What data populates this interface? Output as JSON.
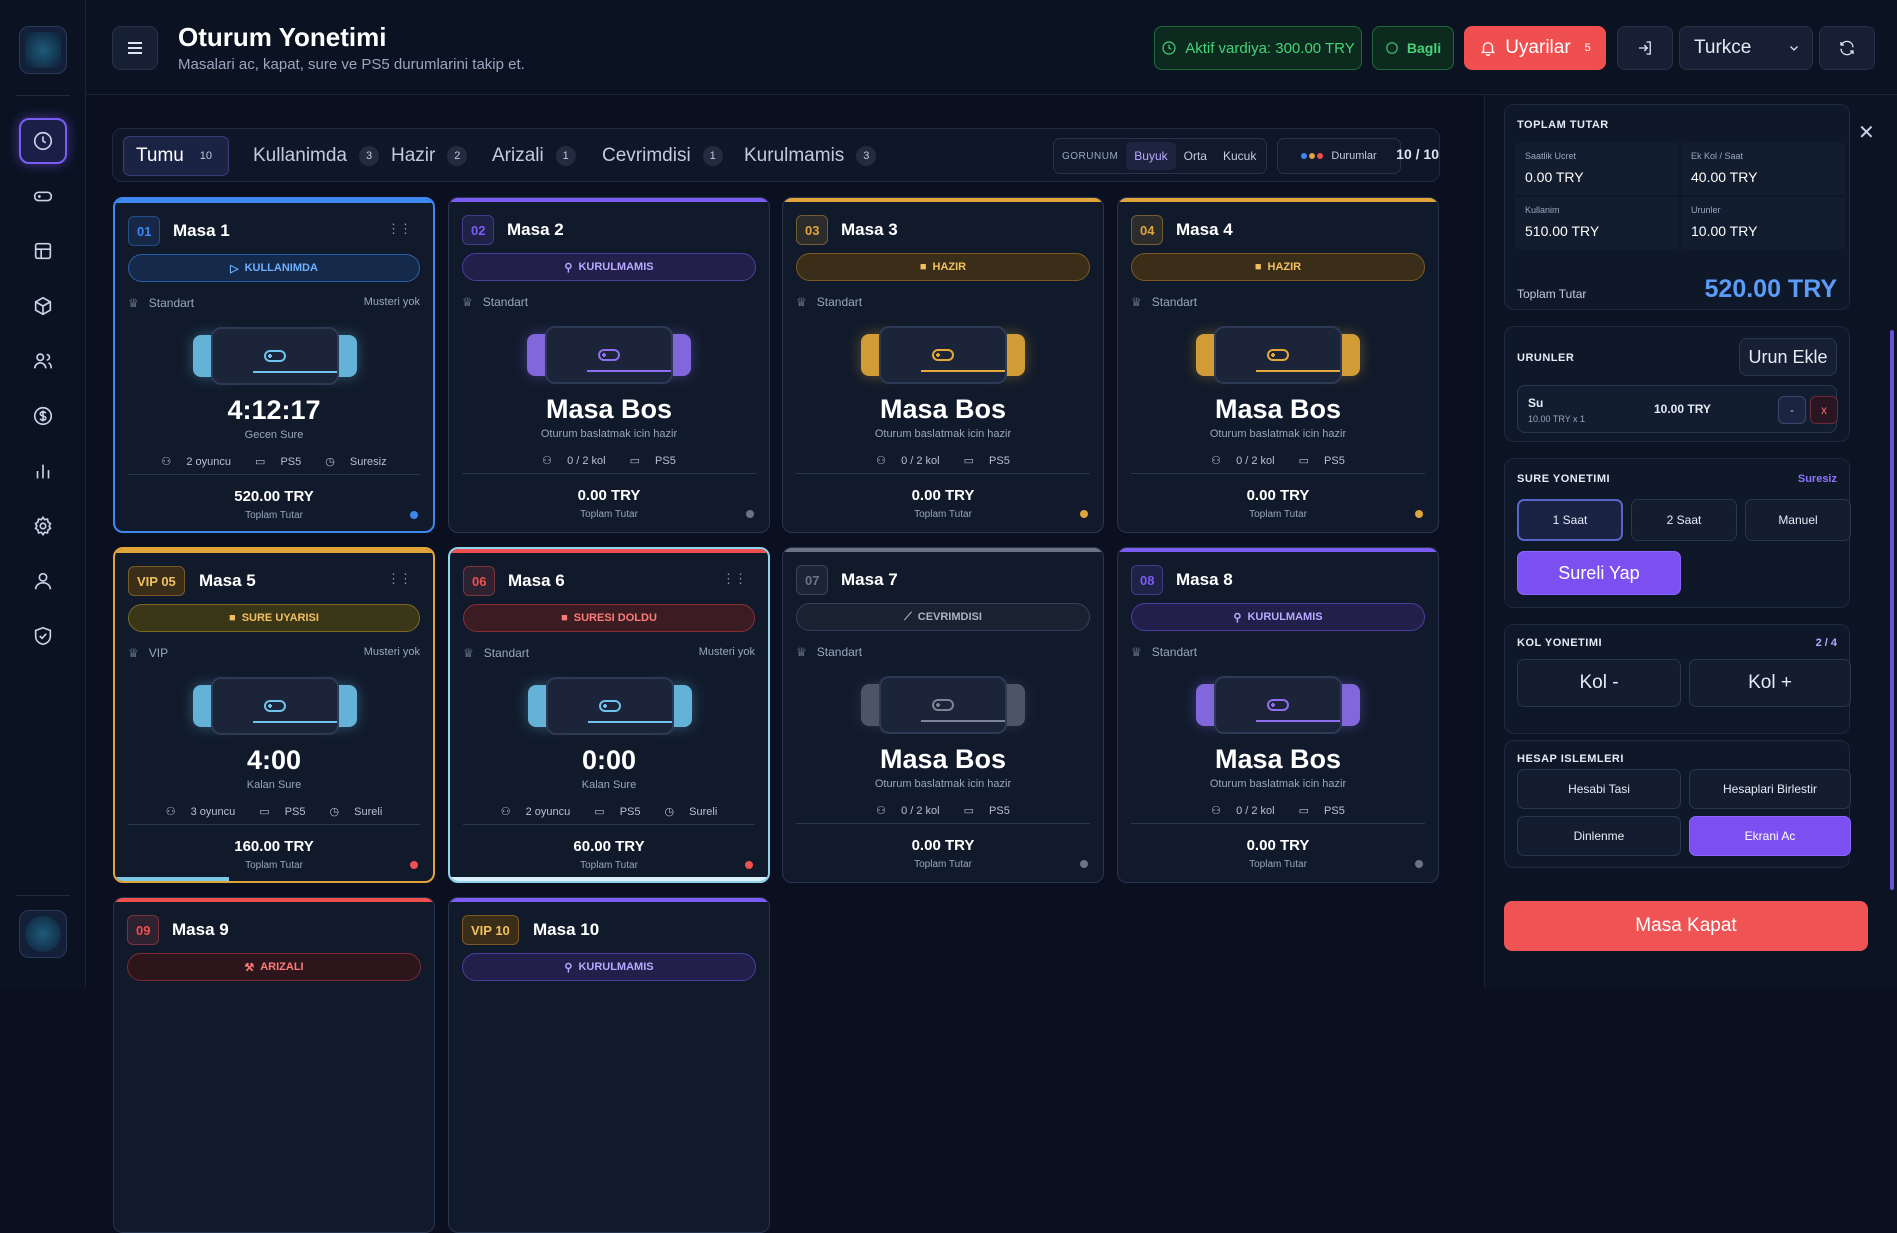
{
  "header": {
    "title": "Oturum Yonetimi",
    "subtitle": "Masalari ac, kapat, sure ve PS5 durumlarini takip et.",
    "shift": "Aktif vardiya: 300.00 TRY",
    "connection": "Bagli",
    "alerts_label": "Uyarilar",
    "alerts_count": "5",
    "language": "Turkce"
  },
  "filters": {
    "tabs": [
      {
        "label": "Tumu",
        "count": "10"
      },
      {
        "label": "Kullanimda",
        "count": "3"
      },
      {
        "label": "Hazir",
        "count": "2"
      },
      {
        "label": "Arizali",
        "count": "1"
      },
      {
        "label": "Cevrimdisi",
        "count": "1"
      },
      {
        "label": "Kurulmamis",
        "count": "3"
      }
    ],
    "view_label": "GORUNUM",
    "view_options": [
      "Buyuk",
      "Orta",
      "Kucuk"
    ],
    "status_button": "Durumlar",
    "page_count": "10 / 10"
  },
  "tables": [
    {
      "num": "01",
      "name": "Masa 1",
      "status": "KULLANIMDA",
      "tier": "Standart",
      "customer": "Musteri yok",
      "big": "4:12:17",
      "big_label": "Gecen Sure",
      "players": "2 oyuncu",
      "console": "PS5",
      "mode": "Suresiz",
      "amount": "520.00 TRY",
      "amount_label": "Toplam Tutar"
    },
    {
      "num": "02",
      "name": "Masa 2",
      "status": "KURULMAMIS",
      "tier": "Standart",
      "customer": "",
      "big": "Masa Bos",
      "big_label": "Oturum baslatmak icin hazir",
      "players": "0 / 2 kol",
      "console": "PS5",
      "mode": "",
      "amount": "0.00 TRY",
      "amount_label": "Toplam Tutar"
    },
    {
      "num": "03",
      "name": "Masa 3",
      "status": "HAZIR",
      "tier": "Standart",
      "customer": "",
      "big": "Masa Bos",
      "big_label": "Oturum baslatmak icin hazir",
      "players": "0 / 2 kol",
      "console": "PS5",
      "mode": "",
      "amount": "0.00 TRY",
      "amount_label": "Toplam Tutar"
    },
    {
      "num": "04",
      "name": "Masa 4",
      "status": "HAZIR",
      "tier": "Standart",
      "customer": "",
      "big": "Masa Bos",
      "big_label": "Oturum baslatmak icin hazir",
      "players": "0 / 2 kol",
      "console": "PS5",
      "mode": "",
      "amount": "0.00 TRY",
      "amount_label": "Toplam Tutar"
    },
    {
      "num": "VIP 05",
      "name": "Masa 5",
      "status": "SURE UYARISI",
      "tier": "VIP",
      "customer": "Musteri yok",
      "big": "4:00",
      "big_label": "Kalan Sure",
      "players": "3 oyuncu",
      "console": "PS5",
      "mode": "Sureli",
      "amount": "160.00 TRY",
      "amount_label": "Toplam Tutar"
    },
    {
      "num": "06",
      "name": "Masa 6",
      "status": "SURESI DOLDU",
      "tier": "Standart",
      "customer": "Musteri yok",
      "big": "0:00",
      "big_label": "Kalan Sure",
      "players": "2 oyuncu",
      "console": "PS5",
      "mode": "Sureli",
      "amount": "60.00 TRY",
      "amount_label": "Toplam Tutar"
    },
    {
      "num": "07",
      "name": "Masa 7",
      "status": "CEVRIMDISI",
      "tier": "Standart",
      "customer": "",
      "big": "Masa Bos",
      "big_label": "Oturum baslatmak icin hazir",
      "players": "0 / 2 kol",
      "console": "PS5",
      "mode": "",
      "amount": "0.00 TRY",
      "amount_label": "Toplam Tutar"
    },
    {
      "num": "08",
      "name": "Masa 8",
      "status": "KURULMAMIS",
      "tier": "Standart",
      "customer": "",
      "big": "Masa Bos",
      "big_label": "Oturum baslatmak icin hazir",
      "players": "0 / 2 kol",
      "console": "PS5",
      "mode": "",
      "amount": "0.00 TRY",
      "amount_label": "Toplam Tutar"
    },
    {
      "num": "09",
      "name": "Masa 9",
      "status": "ARIZALI"
    },
    {
      "num": "VIP 10",
      "name": "Masa 10",
      "status": "KURULMAMIS"
    }
  ],
  "totals": {
    "title": "TOPLAM TUTAR",
    "hourly_label": "Saatlik Ucret",
    "hourly": "0.00 TRY",
    "extra_label": "Ek Kol / Saat",
    "extra": "40.00 TRY",
    "usage_label": "Kullanim",
    "usage": "510.00 TRY",
    "products_label": "Urunler",
    "products": "10.00 TRY",
    "total_label": "Toplam Tutar",
    "total": "520.00 TRY"
  },
  "products": {
    "title": "URUNLER",
    "add_label": "Urun Ekle",
    "item_name": "Su",
    "item_qty": "10.00 TRY x 1",
    "item_price": "10.00 TRY",
    "minus": "-",
    "remove": "x"
  },
  "time": {
    "title": "SURE YONETIMI",
    "mode": "Suresiz",
    "options": [
      "1 Saat",
      "2 Saat",
      "Manuel"
    ],
    "apply_label": "Sureli Yap"
  },
  "controllers": {
    "title": "KOL YONETIMI",
    "count": "2 / 4",
    "minus_label": "Kol -",
    "plus_label": "Kol +"
  },
  "account": {
    "title": "HESAP ISLEMLERI",
    "move": "Hesabi Tasi",
    "merge": "Hesaplari Birlestir",
    "rest": "Dinlenme",
    "screen": "Ekrani Ac"
  },
  "close_table": "Masa Kapat",
  "colors": {
    "blue": "#3f88f2",
    "purple": "#7b5cf5",
    "gold": "#e0a43a",
    "red": "#ef4f4f",
    "grey": "#6b7386",
    "green": "#46d37a"
  }
}
